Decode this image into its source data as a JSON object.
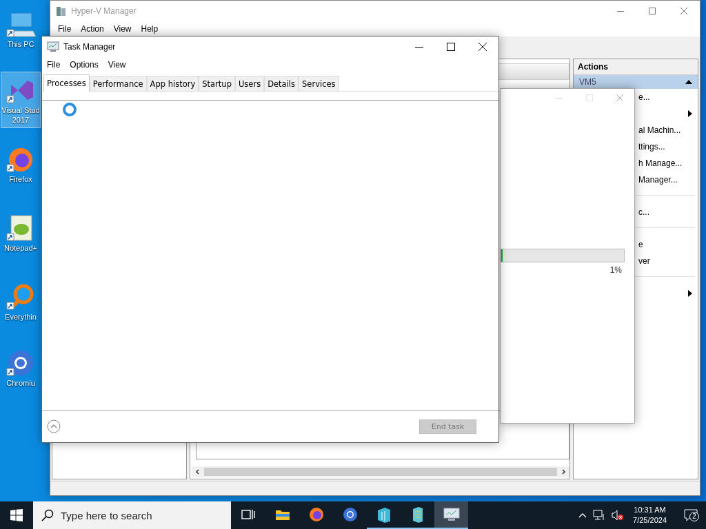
{
  "desktop_icons": [
    {
      "kind": "pc",
      "lines": [
        "This PC"
      ],
      "selected": false
    },
    {
      "kind": "vs",
      "lines": [
        "Visual Stud",
        "2017"
      ],
      "selected": true
    },
    {
      "kind": "firefox",
      "lines": [
        "Firefox"
      ],
      "selected": false
    },
    {
      "kind": "notepad",
      "lines": [
        "Notepad+"
      ],
      "selected": false
    },
    {
      "kind": "everything",
      "lines": [
        "Everythin"
      ],
      "selected": false
    },
    {
      "kind": "chromium",
      "lines": [
        "Chromiu"
      ],
      "selected": false
    }
  ],
  "hyperv": {
    "title": "Hyper-V Manager",
    "menu": [
      "File",
      "Action",
      "View",
      "Help"
    ],
    "actions": {
      "header": "Actions",
      "group": "VM5",
      "items": [
        {
          "kind": "text",
          "label": "e..."
        },
        {
          "kind": "submenu"
        },
        {
          "kind": "text",
          "label": "al Machin..."
        },
        {
          "kind": "text",
          "label": "ttings..."
        },
        {
          "kind": "text",
          "label": "h Manage..."
        },
        {
          "kind": "text",
          "label": "Manager..."
        },
        {
          "kind": "separator"
        },
        {
          "kind": "text",
          "label": "c..."
        },
        {
          "kind": "separator"
        },
        {
          "kind": "text",
          "label": "e"
        },
        {
          "kind": "text",
          "label": "ver"
        },
        {
          "kind": "separator"
        },
        {
          "kind": "submenu"
        }
      ]
    }
  },
  "progress_dialog": {
    "level": 0.01,
    "reading": "1%"
  },
  "task_manager": {
    "title": "Task Manager",
    "menu": [
      "File",
      "Options",
      "View"
    ],
    "tabs": [
      {
        "label": "Processes",
        "selected": true
      },
      {
        "label": "Performance",
        "selected": false
      },
      {
        "label": "App history",
        "selected": false
      },
      {
        "label": "Startup",
        "selected": false
      },
      {
        "label": "Users",
        "selected": false
      },
      {
        "label": "Details",
        "selected": false
      },
      {
        "label": "Services",
        "selected": false
      }
    ],
    "end_task": {
      "label": "End task",
      "disabled": true
    }
  },
  "taskbar": {
    "search": {
      "placeholder": "Type here to search"
    },
    "apps": [
      {
        "kind": "task-view",
        "running": false,
        "selected": false
      },
      {
        "kind": "explorer",
        "running": false,
        "selected": false
      },
      {
        "kind": "firefox",
        "running": false,
        "selected": false
      },
      {
        "kind": "chromium",
        "running": false,
        "selected": false
      },
      {
        "kind": "hyperv",
        "running": true,
        "selected": false
      },
      {
        "kind": "hyperv2",
        "running": true,
        "selected": false
      },
      {
        "kind": "taskmgr",
        "running": true,
        "selected": true
      }
    ],
    "time": "10:31 AM",
    "date": "7/25/2024",
    "notifications": "2"
  }
}
